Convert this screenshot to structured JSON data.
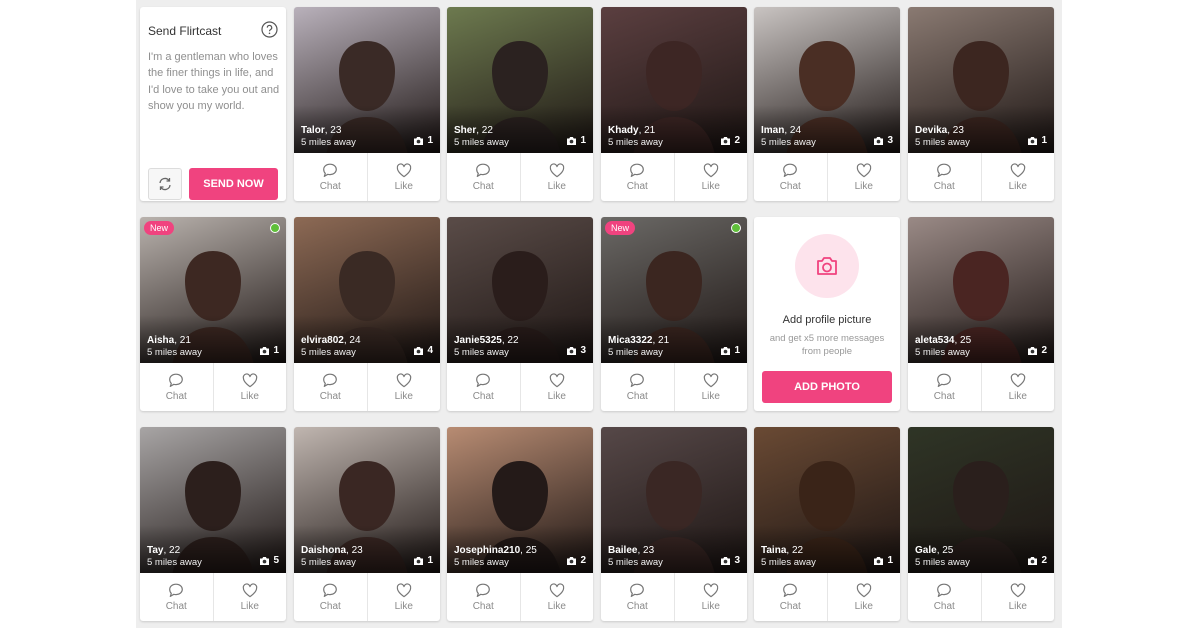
{
  "flirtcast": {
    "title": "Send Flirtcast",
    "message": "I'm a gentleman who loves the finer things in life, and I'd love to take you out and show you my world.",
    "send_label": "SEND NOW"
  },
  "add_photo": {
    "title": "Add profile picture",
    "subtitle": "and get x5 more messages from people",
    "button_label": "ADD PHOTO"
  },
  "actions": {
    "chat_label": "Chat",
    "like_label": "Like"
  },
  "new_badge": "New",
  "colors": {
    "accent": "#f0437f",
    "online": "#5fbf3a"
  },
  "profiles": [
    {
      "name": "Talor",
      "age": ", 23",
      "distance": "5 miles away",
      "photos": "1",
      "bg": "#b9b1bb",
      "tone": "#3a2a26"
    },
    {
      "name": "Sher",
      "age": ", 22",
      "distance": "5 miles away",
      "photos": "1",
      "bg": "#6d7a4f",
      "tone": "#2b2220"
    },
    {
      "name": "Khady",
      "age": ", 21",
      "distance": "5 miles away",
      "photos": "2",
      "bg": "#5b3f40",
      "tone": "#3d2624"
    },
    {
      "name": "Iman",
      "age": ", 24",
      "distance": "5 miles away",
      "photos": "3",
      "bg": "#c9c4c2",
      "tone": "#4a2e24"
    },
    {
      "name": "Devika",
      "age": ", 23",
      "distance": "5 miles away",
      "photos": "1",
      "bg": "#8a7a72",
      "tone": "#3c2620"
    },
    {
      "name": "Aisha",
      "age": ", 21",
      "distance": "5 miles away",
      "photos": "1",
      "bg": "#b9b2ad",
      "tone": "#3d2822",
      "new": true,
      "online": true
    },
    {
      "name": "elvira802",
      "age": ", 24",
      "distance": "5 miles away",
      "photos": "4",
      "bg": "#8d6a55",
      "tone": "#3a2a24"
    },
    {
      "name": "Janie5325",
      "age": ", 22",
      "distance": "5 miles away",
      "photos": "3",
      "bg": "#5a4c48",
      "tone": "#2a1d1b"
    },
    {
      "name": "Mica3322",
      "age": ", 21",
      "distance": "5 miles away",
      "photos": "1",
      "bg": "#6b6966",
      "tone": "#3b2620",
      "new": true,
      "online": true
    },
    {
      "name": "aleta534",
      "age": ", 25",
      "distance": "5 miles away",
      "photos": "2",
      "bg": "#9a8a86",
      "tone": "#4a2522"
    },
    {
      "name": "Tay",
      "age": ", 22",
      "distance": "5 miles away",
      "photos": "5",
      "bg": "#a8a5a5",
      "tone": "#2c1f1c"
    },
    {
      "name": "Daishona",
      "age": ", 23",
      "distance": "5 miles away",
      "photos": "1",
      "bg": "#c0b6b0",
      "tone": "#3a2723"
    },
    {
      "name": "Josephina210",
      "age": ", 25",
      "distance": "5 miles away",
      "photos": "2",
      "bg": "#b88c73",
      "tone": "#241a18"
    },
    {
      "name": "Bailee",
      "age": ", 23",
      "distance": "5 miles away",
      "photos": "3",
      "bg": "#564848",
      "tone": "#3a2724"
    },
    {
      "name": "Taina",
      "age": ", 22",
      "distance": "5 miles away",
      "photos": "1",
      "bg": "#6a4a34",
      "tone": "#3a2418"
    },
    {
      "name": "Gale",
      "age": ", 25",
      "distance": "5 miles away",
      "photos": "2",
      "bg": "#2f3526",
      "tone": "#2a1f1c"
    }
  ],
  "icons": {
    "help": "help-circle-icon",
    "refresh": "refresh-icon",
    "camera": "camera-icon",
    "chat": "chat-bubble-icon",
    "like": "heart-icon"
  }
}
